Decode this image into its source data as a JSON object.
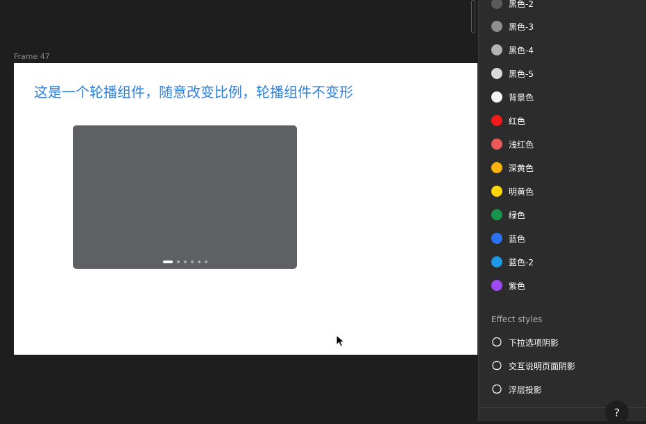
{
  "canvas": {
    "frame_label": "Frame 47",
    "frame": {
      "heading": "这是一个轮播组件，随意改变比例，轮播组件不变形",
      "carousel": {
        "dot_count": 6,
        "active_index": 0
      }
    }
  },
  "panel": {
    "color_styles": [
      {
        "label": "黑色-2",
        "color": "#5b5b5b"
      },
      {
        "label": "黑色-3",
        "color": "#8e8e8e"
      },
      {
        "label": "黑色-4",
        "color": "#b3b3b3"
      },
      {
        "label": "黑色-5",
        "color": "#d9d9d9"
      },
      {
        "label": "背景色",
        "color": "#f5f5f5"
      },
      {
        "label": "红色",
        "color": "#f21b1b"
      },
      {
        "label": "浅红色",
        "color": "#ea5a5a"
      },
      {
        "label": "深黄色",
        "color": "#f8b40c"
      },
      {
        "label": "明黄色",
        "color": "#ffd60a"
      },
      {
        "label": "绿色",
        "color": "#16944a"
      },
      {
        "label": "蓝色",
        "color": "#2b72f0"
      },
      {
        "label": "蓝色-2",
        "color": "#1f9aeb"
      },
      {
        "label": "紫色",
        "color": "#9d4af0"
      }
    ],
    "effect_styles_title": "Effect styles",
    "effect_styles": [
      {
        "label": "下拉选项阴影",
        "icon": "drop-shadow-icon"
      },
      {
        "label": "交互说明页面阴影",
        "icon": "drop-shadow-icon"
      },
      {
        "label": "浮层投影",
        "icon": "drop-shadow-icon"
      }
    ]
  },
  "help": {
    "label": "?"
  }
}
